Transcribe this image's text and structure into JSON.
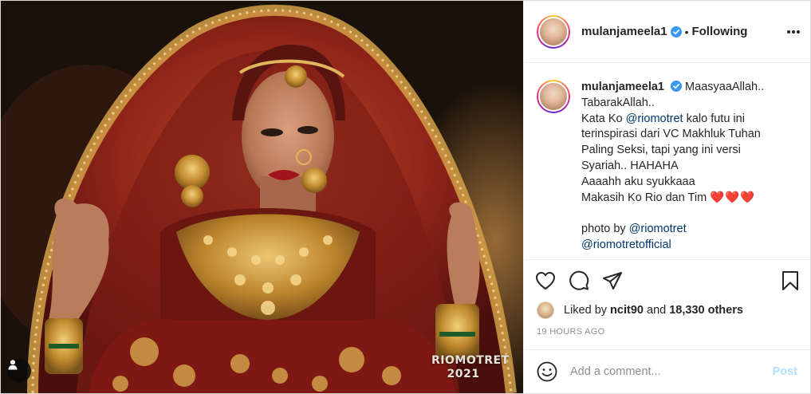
{
  "photo": {
    "watermark_line1": "RIOMOTRET",
    "watermark_line2": "2021",
    "tag_icon": "user-tag-icon"
  },
  "header": {
    "username": "mulanjameela1",
    "separator": "•",
    "follow_label": "Following",
    "more_icon": "more-options-icon"
  },
  "caption": {
    "username": "mulanjameela1",
    "lines": [
      "MaasyaaAllah..",
      "TabarakAllah..",
      "Kata Ko ",
      "@riomotret",
      " kalo futu ini",
      "terinspirasi dari VC Makhluk Tuhan",
      "Paling Seksi, tapi yang ini versi",
      "Syariah.. HAHAHA",
      "Aaaahh aku syukkaaa",
      "Makasih Ko Rio dan Tim ",
      "❤️❤️❤️",
      "photo by ",
      "@riomotret",
      "@riomotretofficial"
    ]
  },
  "actions": {
    "like_icon": "heart-icon",
    "comment_icon": "comment-icon",
    "share_icon": "share-icon",
    "save_icon": "bookmark-icon"
  },
  "likes": {
    "prefix": "Liked by ",
    "user": "ncit90",
    "middle": " and ",
    "count": "18,330 others"
  },
  "timestamp": "19 HOURS AGO",
  "comment": {
    "placeholder": "Add a comment...",
    "post_label": "Post"
  },
  "colors": {
    "mention": "#00376b",
    "post_disabled": "#b2dffc",
    "verified": "#3897f0",
    "heart": "#e0142e"
  }
}
